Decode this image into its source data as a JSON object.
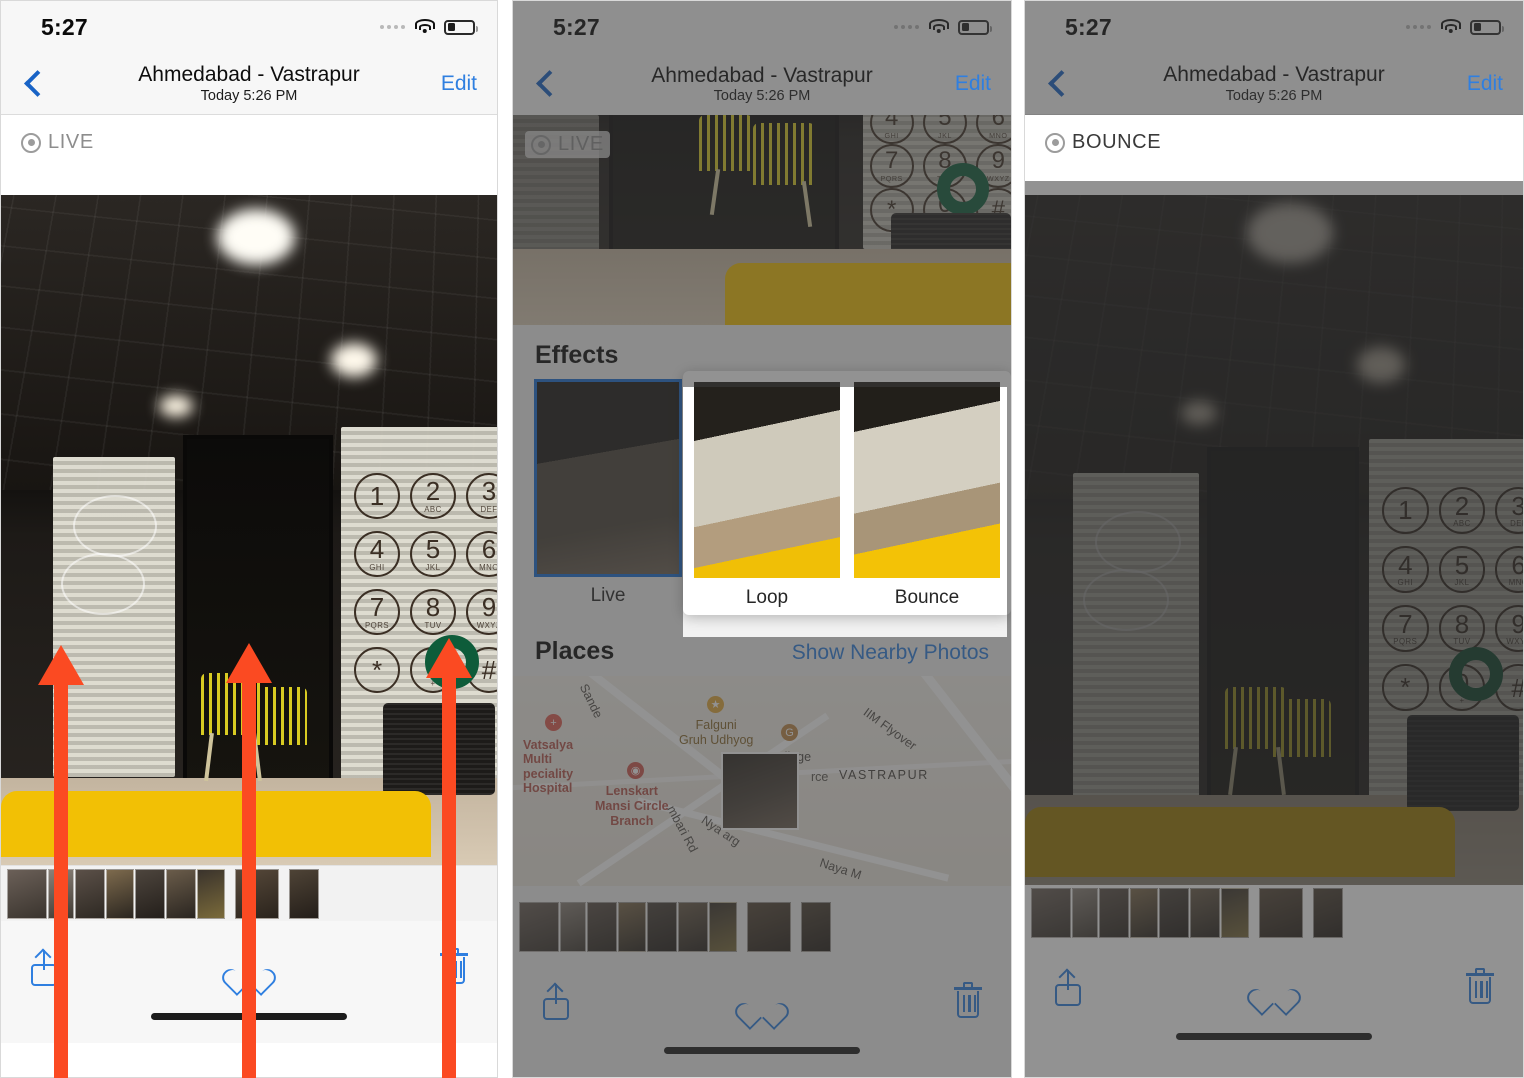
{
  "panels": [
    {
      "id": "live-view",
      "status": {
        "time": "5:27",
        "cellular": "signal-dots",
        "wifi": "wifi-icon",
        "battery": "battery-low-icon"
      },
      "nav": {
        "back": "back-chevron-icon",
        "title": "Ahmedabad - Vastrapur",
        "subtitle": "Today  5:26 PM",
        "edit": "Edit"
      },
      "badge": {
        "icon": "live-photo-icon",
        "label": "LIVE"
      },
      "toolbar": {
        "share": "share-icon",
        "favorite": "heart-icon",
        "delete": "trash-icon"
      }
    },
    {
      "id": "effects-sheet",
      "status": {
        "time": "5:27",
        "cellular": "signal-dots",
        "wifi": "wifi-icon",
        "battery": "battery-low-icon"
      },
      "nav": {
        "back": "back-chevron-icon",
        "title": "Ahmedabad - Vastrapur",
        "subtitle": "Today  5:26 PM",
        "edit": "Edit"
      },
      "badge": {
        "icon": "live-photo-icon",
        "label": "LIVE"
      },
      "effects": {
        "title": "Effects",
        "items": [
          {
            "label": "Live",
            "selected": true
          },
          {
            "label": "Loop",
            "selected": false
          },
          {
            "label": "Bounce",
            "selected": false
          }
        ]
      },
      "places": {
        "title": "Places",
        "action": "Show Nearby Photos",
        "map_labels": [
          "Sande",
          "Vatsalya Multi peciality Hospital",
          "Lenskart Mansi Circle Branch",
          "Falguni Gruh Udhyog",
          "L J College",
          "rce",
          "VASTRAPUR",
          "IIM Flyover",
          "mbari Rd",
          "Nya   arg",
          "Naya M"
        ]
      },
      "toolbar": {
        "share": "share-icon",
        "favorite": "heart-icon",
        "delete": "trash-icon"
      }
    },
    {
      "id": "bounce-applied",
      "status": {
        "time": "5:27",
        "cellular": "signal-dots",
        "wifi": "wifi-icon",
        "battery": "battery-low-icon"
      },
      "nav": {
        "back": "back-chevron-icon",
        "title": "Ahmedabad - Vastrapur",
        "subtitle": "Today  5:26 PM",
        "edit": "Edit"
      },
      "badge": {
        "icon": "live-photo-icon",
        "label": "BOUNCE"
      },
      "toolbar": {
        "share": "share-icon",
        "favorite": "heart-icon",
        "delete": "trash-icon"
      }
    }
  ],
  "annotations": {
    "arrow_color": "#fb4a22",
    "arrows": [
      {
        "name": "arrow-left"
      },
      {
        "name": "arrow-center"
      },
      {
        "name": "arrow-right"
      }
    ]
  },
  "keypad": {
    "keys": [
      {
        "num": "1",
        "abc": ""
      },
      {
        "num": "2",
        "abc": "ABC"
      },
      {
        "num": "3",
        "abc": "DEF"
      },
      {
        "num": "4",
        "abc": "GHI"
      },
      {
        "num": "5",
        "abc": "JKL"
      },
      {
        "num": "6",
        "abc": "MNO"
      },
      {
        "num": "7",
        "abc": "PQRS"
      },
      {
        "num": "8",
        "abc": "TUV"
      },
      {
        "num": "9",
        "abc": "WXYZ"
      },
      {
        "num": "*",
        "abc": ""
      },
      {
        "num": "0",
        "abc": "+"
      },
      {
        "num": "#",
        "abc": ""
      }
    ]
  },
  "colors": {
    "accent_blue": "#2f7fe0",
    "selection_blue": "#1a6fd4",
    "arrow_red": "#fb4a22",
    "chrome": "#f7f7f7"
  }
}
